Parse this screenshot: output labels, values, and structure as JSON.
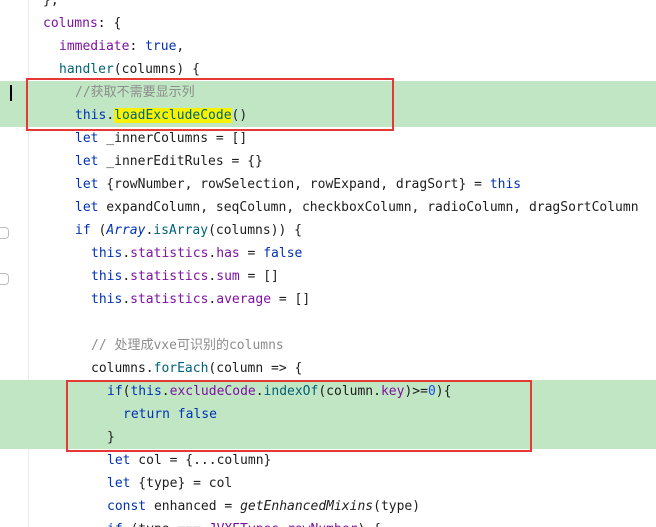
{
  "editor": {
    "lines": [
      "},",
      "columns: {",
      "immediate: true,",
      "handler(columns) {",
      "//获取不需要显示列",
      "this.loadExcludeCode()",
      "let _innerColumns = []",
      "let _innerEditRules = {}",
      "let {rowNumber, rowSelection, rowExpand, dragSort} = this",
      "let expandColumn, seqColumn, checkboxColumn, radioColumn, dragSortColumn",
      "if (Array.isArray(columns)) {",
      "this.statistics.has = false",
      "this.statistics.sum = []",
      "this.statistics.average = []",
      "",
      "// 处理成vxe可识别的columns",
      "columns.forEach(column => {",
      "if(this.excludeCode.indexOf(column.key)>=0){",
      "return false",
      "}",
      "let col = {...column}",
      "let {type} = col",
      "const enhanced = getEnhancedMixins(type)",
      "if (type === JVXETypes.rowNumber) {"
    ]
  },
  "colors": {
    "highlight_bg": "#c0e6c4",
    "annotation_box": "#e53935",
    "search_match": "#f6f200"
  }
}
